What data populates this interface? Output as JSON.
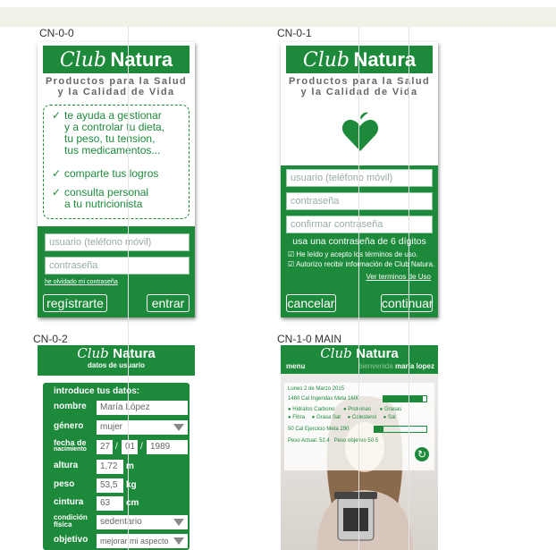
{
  "frames": {
    "cn00": "CN-0-0",
    "cn01": "CN-0-1",
    "cn02": "CN-0-2",
    "cn10": "CN-1-0 MAIN"
  },
  "brand": {
    "club": "Club",
    "natura": "Natura"
  },
  "tagline": {
    "line1": "Productos para la Salud",
    "line2": "y la Calidad de Vida"
  },
  "login": {
    "features": [
      "te ayuda a gestionar\ny a controlar tu dieta,\ntu peso, tu tension,\ntus medicamentos...",
      "comparte tus logros",
      "consulta personal\na tu nutricionista"
    ],
    "user_placeholder": "usuario (teléfono móvil)",
    "password_placeholder": "contraseña",
    "forgot_link": "he olvidado mi contraseña",
    "register_button": "regístrarte",
    "enter_button": "entrar"
  },
  "register": {
    "user_placeholder": "usuario (teléfono móvil)",
    "password_placeholder": "contraseña",
    "confirm_placeholder": "confirmar contraseña",
    "hint": "usa una contraseña de 6 dígitos",
    "check1": "He leído y acepto los términos de uso.",
    "check2": "Autorizo recibir información de Club Natura.",
    "terms_link": "Ver terminos de Uso",
    "cancel_button": "cancelar",
    "continue_button": "continuar"
  },
  "profile": {
    "subtitle": "datos de usuario",
    "intro": "introduce tus datos:",
    "fields": {
      "nombre_label": "nombre",
      "nombre_value": "María López",
      "genero_label": "género",
      "genero_value": "mujer",
      "fecha_label1": "fecha de",
      "fecha_label2": "nacimiento",
      "day": "27",
      "month": "01",
      "year": "1989",
      "sep": "/",
      "altura_label": "altura",
      "altura_value": "1,72",
      "altura_unit": "m",
      "peso_label": "peso",
      "peso_value": "53,5",
      "peso_unit": "kg",
      "cintura_label": "cintura",
      "cintura_value": "63",
      "cintura_unit": "cm",
      "condicion_label1": "condición",
      "condicion_label2": "física",
      "condicion_value": "sedentario",
      "objetivo_label": "objetivo",
      "objetivo_value": "mejorar mi aspecto"
    }
  },
  "main": {
    "menu": "menu",
    "welcome": "bienvenida",
    "user": "maría lopez",
    "date": "Lunes 2 de Marzo 2015",
    "intake": "1460 Cal Ingeridas Meta 1600",
    "intake_fraction": 0.91,
    "nutrients": [
      "Hidratos Carbono",
      "Proteínas",
      "Grasas",
      "Fibra",
      "Grasa Sat",
      "Colesterol",
      "Sal"
    ],
    "exercise": "50 Cal Ejercicio Meta 290",
    "exercise_fraction": 0.17,
    "weight_actual": "Peso Actual: 52.4",
    "weight_goal": "Peso objetivo 50.5"
  },
  "colors": {
    "brand_green": "#1d8a3b",
    "light_green": "#8fc59b"
  }
}
